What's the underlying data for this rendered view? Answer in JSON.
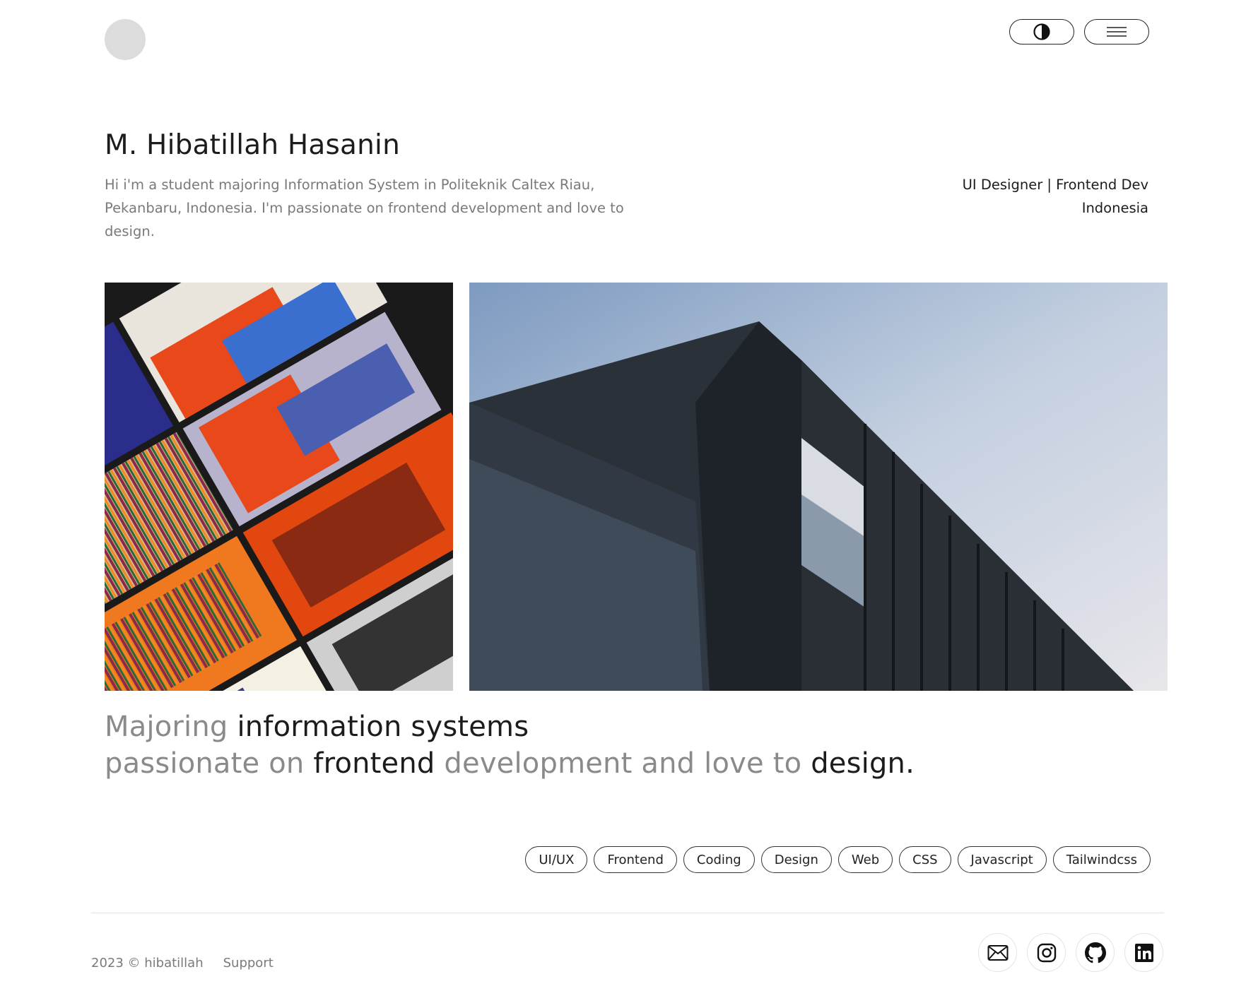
{
  "header": {
    "avatar": "avatar-placeholder",
    "theme_toggle_icon": "contrast-icon",
    "menu_icon": "hamburger-menu-icon"
  },
  "hero": {
    "name": "M. Hibatillah Hasanin",
    "bio": "Hi i'm a student majoring Information System in Politeknik Caltex Riau, Pekanbaru, Indonesia. I'm passionate on frontend development and love to design.",
    "role": "UI Designer | Frontend Dev",
    "location": "Indonesia"
  },
  "gallery": {
    "left_image": "abstract-paintings-photo",
    "right_image": "building-facade-photo"
  },
  "tagline": {
    "line1_a": "Majoring ",
    "line1_b": "information systems",
    "line2_a": "passionate on ",
    "line2_b": "frontend",
    "line2_c": " development and love to ",
    "line2_d": "design."
  },
  "tags": [
    "UI/UX",
    "Frontend",
    "Coding",
    "Design",
    "Web",
    "CSS",
    "Javascript",
    "Tailwindcss"
  ],
  "footer": {
    "copyright": "2023 © hibatillah",
    "support": "Support",
    "social": [
      "mail-icon",
      "instagram-icon",
      "github-icon",
      "linkedin-icon"
    ]
  }
}
